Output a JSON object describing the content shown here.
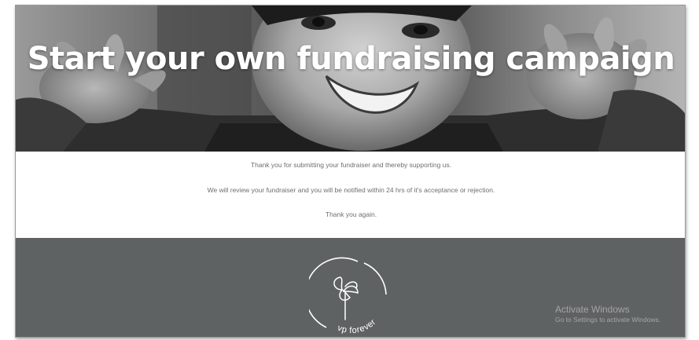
{
  "hero": {
    "title": "Start your own fundraising campaign"
  },
  "message": {
    "line1": "Thank you for submitting your fundraiser and thereby supporting us.",
    "line2": "We will review your fundraiser and you will be notified within 24 hrs of it's acceptance or rejection.",
    "line3": "Thank you again."
  },
  "footer": {
    "logo_text": "vp forever",
    "background_color": "#5f6263"
  },
  "watermark": {
    "title": "Activate Windows",
    "subtitle": "Go to Settings to activate Windows."
  }
}
